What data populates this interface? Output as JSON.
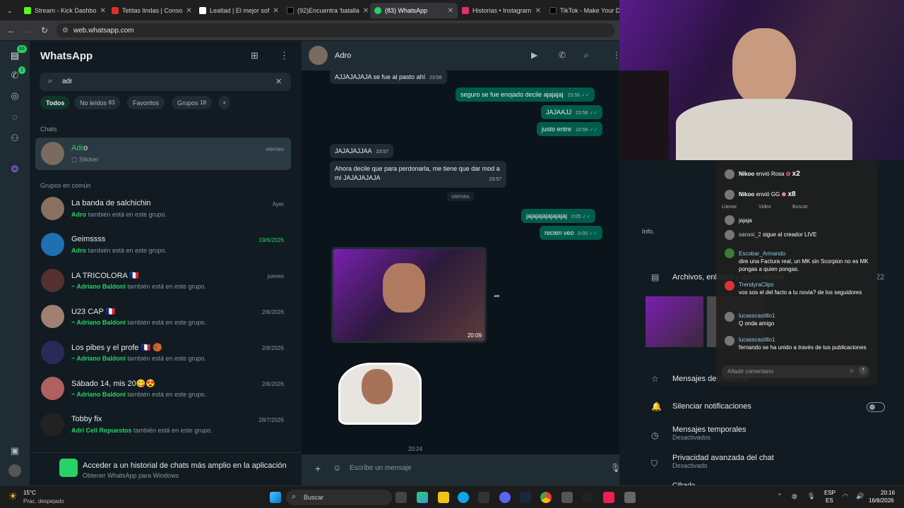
{
  "browser": {
    "tabs": [
      {
        "label": "Stream - Kick Dashbo",
        "color": "#53fc18"
      },
      {
        "label": "Tetitas lindas | Conso",
        "color": "#d93025"
      },
      {
        "label": "Lealtad | El mejor sof",
        "color": "#ffffff"
      },
      {
        "label": "(92)Encuentra 'batalla",
        "color": "#000000"
      },
      {
        "label": "(83) WhatsApp",
        "color": "#25d366"
      },
      {
        "label": "Historias • Instagram",
        "color": "#e1306c"
      },
      {
        "label": "TikTok - Make Your D",
        "color": "#000000"
      }
    ],
    "url": "web.whatsapp.com"
  },
  "rail": {
    "chats_badge": "83",
    "calls_badge": "1"
  },
  "sidebar": {
    "title": "WhatsApp",
    "search_value": "adr",
    "filters": [
      {
        "label": "Todos"
      },
      {
        "label": "No leídos",
        "count": "83"
      },
      {
        "label": "Favoritos"
      },
      {
        "label": "Grupos",
        "count": "18"
      }
    ],
    "section_chats": "Chats",
    "chat": {
      "name_match": "Adr",
      "name_rest": "o",
      "sub": "Sticker",
      "date": "viernes"
    },
    "section_groups": "Grupos en común",
    "groups": [
      {
        "name": "La banda de salchichin",
        "who": "Adro",
        "rest": " también está en este grupo.",
        "date": "Ayer",
        "unread": false
      },
      {
        "name": "Geimssss",
        "who": "Adro",
        "rest": " también está en este grupo.",
        "date": "19/6/2026",
        "unread": true
      },
      {
        "name": "LA TRICOLORA 🇫🇷",
        "who": "~ Adriano Baldoni",
        "rest": " también está en este grupo.",
        "date": "jueves",
        "unread": false
      },
      {
        "name": "U23 CAP 🇫🇷",
        "who": "~ Adriano Baldoni",
        "rest": " también está en este grupo.",
        "date": "2/8/2026",
        "unread": false
      },
      {
        "name": "Los pibes y el profe 🇫🇷 🏀",
        "who": "~ Adriano Baldoni",
        "rest": " también está en este grupo.",
        "date": "2/8/2026",
        "unread": false
      },
      {
        "name": "Sábado 14, mis 20😋😍",
        "who": "~ Adriano Baldoni",
        "rest": " también está en este grupo.",
        "date": "2/8/2026",
        "unread": false
      },
      {
        "name": "Tobby fix",
        "who": "Adri Cell Repuestos",
        "rest": " también está en este grupo.",
        "date": "28/7/2026",
        "unread": false
      }
    ],
    "promo_title": "Acceder a un historial de chats más amplio en la aplicación",
    "promo_sub": "Obtener WhatsApp para Windows"
  },
  "chat": {
    "contact": "Adro",
    "messages_in_1": {
      "text": "AJJAJAJAJA se fue al pasto ahí",
      "time": "23:56"
    },
    "out_1": {
      "text": "seguro se fue enojado decile ajajajaj",
      "time": "23:56"
    },
    "out_2": {
      "text": "JAJAAJJ",
      "time": "23:56"
    },
    "out_3": {
      "text": "justo entre",
      "time": "23:56"
    },
    "in_2": {
      "text": "JAJAJAJJAA",
      "time": "23:57"
    },
    "in_3": {
      "text": "Ahora decile que para perdonarla, me tiene que dar mod a mi JAJAJAJAJA",
      "time": "23:57"
    },
    "day_divider": "viernes",
    "out_4": {
      "text": "jajajajajajajajaj",
      "time": "0:05"
    },
    "out_5": {
      "text": "recien veo",
      "time": "0:05"
    },
    "video_time": "20:09",
    "sticker_time": "20:24",
    "composer_placeholder": "Escribe un mensaje"
  },
  "live": {
    "gifts": [
      {
        "user": "Nikoo",
        "action": "envió Rosa",
        "mult": "x2"
      },
      {
        "user": "Nikoo",
        "action": "envió GG",
        "mult": "x8"
      }
    ],
    "tabs": [
      "Llamar",
      "Video",
      "Buscar"
    ],
    "comments": [
      {
        "user": "",
        "text": "jajaja"
      },
      {
        "user": "sanxxi_2",
        "text": "sigue al creador LIVE"
      },
      {
        "user": "Escobar_Armando",
        "text": "dire una Factura real, un MK sin Scorpion no es MK pongas a quien pongas."
      },
      {
        "user": "TrendyraClips",
        "text": "vos sos el del facto a tu novia? de los seguidores"
      },
      {
        "user": "lucasscastillo1",
        "text": "Q onda amigo"
      },
      {
        "user": "lucasscastillo1",
        "text": "fernando se ha unido a través de tus publicaciones"
      }
    ],
    "placeholder": "Añadir comentario"
  },
  "contact_info": {
    "info_label": "Info.",
    "files": "Archivos, enlaces y documentos",
    "files_count": "22",
    "starred": "Mensajes destacados",
    "mute": "Silenciar notificaciones",
    "temp": "Mensajes temporales",
    "temp_sub": "Desactivados",
    "privacy": "Privacidad avanzada del chat",
    "privacy_sub": "Desactivado",
    "encrypt": "Cifrado"
  },
  "taskbar": {
    "weather": "15°C",
    "weather_sub": "Prac. despejado",
    "search": "Buscar",
    "lang": "ESP",
    "lang2": "ES",
    "time": "20:16",
    "date": "16/8/2026"
  }
}
